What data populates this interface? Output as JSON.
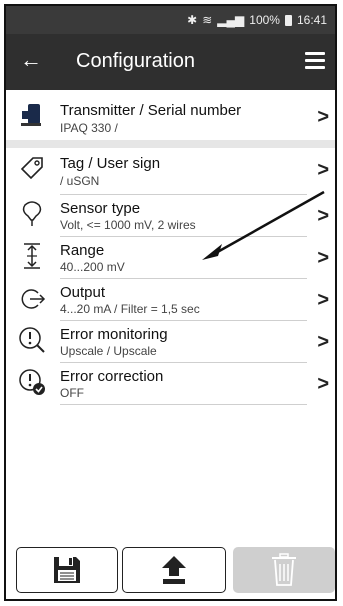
{
  "status": {
    "battery": "100%",
    "time": "16:41"
  },
  "appbar": {
    "title": "Configuration"
  },
  "items": [
    {
      "title": "Transmitter / Serial number",
      "subtitle": "IPAQ 330 /",
      "icon": "device-icon"
    },
    {
      "title": "Tag / User sign",
      "subtitle": "/ uSGN",
      "icon": "tag-icon"
    },
    {
      "title": "Sensor type",
      "subtitle": "Volt, <= 1000 mV, 2 wires",
      "icon": "sensor-icon"
    },
    {
      "title": "Range",
      "subtitle": "40...200 mV",
      "icon": "range-icon"
    },
    {
      "title": "Output",
      "subtitle": "4...20 mA / Filter = 1,5 sec",
      "icon": "output-icon"
    },
    {
      "title": "Error monitoring",
      "subtitle": "Upscale / Upscale",
      "icon": "error-monitoring-icon"
    },
    {
      "title": "Error correction",
      "subtitle": "OFF",
      "icon": "error-correction-icon"
    }
  ],
  "bottom_buttons": [
    {
      "name": "save",
      "icon": "floppy-disk-icon",
      "enabled": true
    },
    {
      "name": "upload",
      "icon": "upload-icon",
      "enabled": true
    },
    {
      "name": "delete",
      "icon": "trash-icon",
      "enabled": false
    }
  ]
}
